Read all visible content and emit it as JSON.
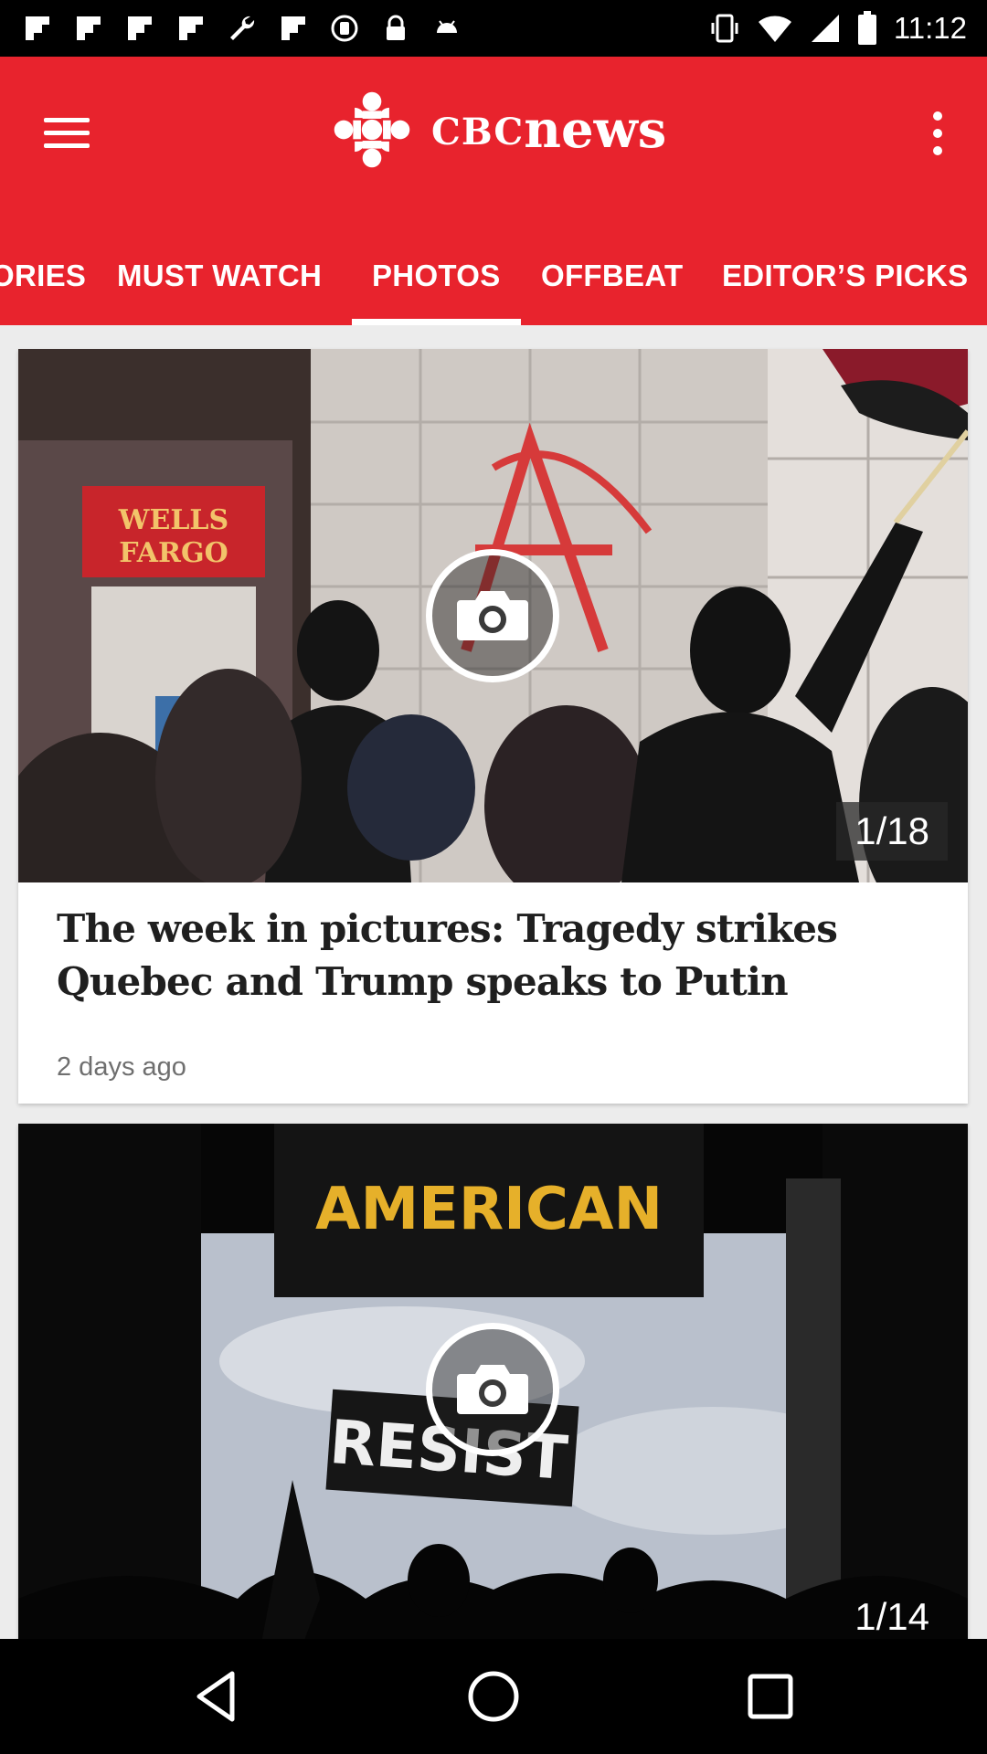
{
  "status_bar": {
    "time": "11:12",
    "left_icons": [
      "flipboard-icon",
      "flipboard-icon",
      "flipboard-icon",
      "flipboard-icon",
      "wrench-icon",
      "flipboard-icon",
      "registered-icon",
      "lock-icon",
      "android-icon"
    ],
    "right_icons": [
      "vibrate-icon",
      "wifi-icon",
      "signal-icon",
      "battery-icon"
    ]
  },
  "header": {
    "menu_icon": "hamburger-menu-icon",
    "logo": {
      "prefix": "CBC",
      "word": "news"
    },
    "overflow_icon": "overflow-menu-icon",
    "brand_color": "#e8232d"
  },
  "tabs": [
    {
      "label": "ORIES",
      "active": false
    },
    {
      "label": "MUST WATCH",
      "active": false
    },
    {
      "label": "PHOTOS",
      "active": true
    },
    {
      "label": "OFFBEAT",
      "active": false
    },
    {
      "label": "EDITOR’S PICKS",
      "active": false
    }
  ],
  "cards": [
    {
      "photo_count": "1/18",
      "image_text": [
        "WELLS",
        "FARGO"
      ],
      "title": "The week in pictures: Tragedy strikes Quebec and Trump speaks to Putin",
      "meta": "2 days ago",
      "icon": "camera-icon"
    },
    {
      "photo_count": "1/14",
      "image_text": [
        "AMERICAN",
        "RESIST"
      ],
      "icon": "camera-icon"
    }
  ],
  "nav_bar": {
    "back_icon": "back-triangle-icon",
    "home_icon": "home-circle-icon",
    "recent_icon": "recent-apps-square-icon"
  }
}
